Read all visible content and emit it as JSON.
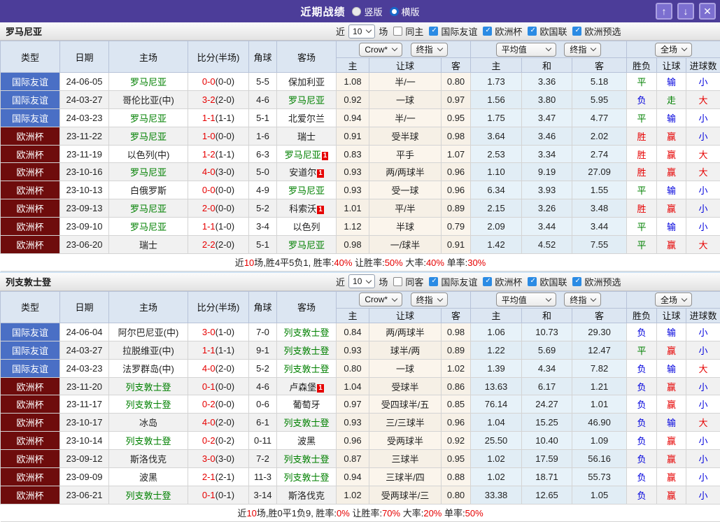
{
  "window": {
    "title": "近期战绩",
    "radio_vertical": "竖版",
    "radio_horizontal": "横版",
    "btn_up": "↑",
    "btn_down": "↓",
    "btn_close": "✕"
  },
  "colors": {
    "titlebar": "#4C3D99",
    "badge_friendly": "#4A6FC5",
    "badge_eurocup": "#6E0C0C",
    "team_green": "#008000",
    "score_red": "#E60000",
    "loss_blue": "#0000DD",
    "checkbox_blue": "#2B8BE4"
  },
  "table_columns": {
    "left": [
      "类型",
      "日期",
      "主场",
      "比分(半场)",
      "角球",
      "客场"
    ],
    "crow_group": {
      "select1": "Crow*",
      "select2": "终指",
      "cols": [
        "主",
        "让球",
        "客"
      ]
    },
    "avg_group": {
      "select1": "平均值",
      "select2": "终指",
      "cols": [
        "主",
        "和",
        "客"
      ]
    },
    "result_group": {
      "select1": "全场",
      "cols": [
        "胜负",
        "让球",
        "进球数"
      ]
    }
  },
  "sections": [
    {
      "team": "罗马尼亚",
      "filter": {
        "prefix": "近",
        "count": "10",
        "suffix": "场",
        "same": "同主",
        "same_checked": false,
        "leagues": [
          {
            "label": "国际友谊",
            "checked": true
          },
          {
            "label": "欧洲杯",
            "checked": true
          },
          {
            "label": "欧国联",
            "checked": true
          },
          {
            "label": "欧洲预选",
            "checked": true
          }
        ]
      },
      "rows": [
        {
          "type": "国际友谊",
          "type_style": "blue",
          "date": "24-06-05",
          "home": "罗马尼亚",
          "home_green": true,
          "home_badge": "",
          "score": "0-0",
          "half": "(0-0)",
          "corner": "5-5",
          "away": "保加利亚",
          "away_green": false,
          "away_badge": "",
          "crow": [
            "1.08",
            "半/一",
            "0.80"
          ],
          "avg": [
            "1.73",
            "3.36",
            "5.18"
          ],
          "results": [
            [
              "平",
              "g"
            ],
            [
              "输",
              "b"
            ],
            [
              "小",
              "b"
            ]
          ]
        },
        {
          "type": "国际友谊",
          "type_style": "blue",
          "date": "24-03-27",
          "home": "哥伦比亚(中)",
          "home_green": false,
          "home_badge": "",
          "score": "3-2",
          "half": "(2-0)",
          "corner": "4-6",
          "away": "罗马尼亚",
          "away_green": true,
          "away_badge": "",
          "crow": [
            "0.92",
            "一球",
            "0.97"
          ],
          "avg": [
            "1.56",
            "3.80",
            "5.95"
          ],
          "results": [
            [
              "负",
              "b"
            ],
            [
              "走",
              "g"
            ],
            [
              "大",
              "r"
            ]
          ]
        },
        {
          "type": "国际友谊",
          "type_style": "blue",
          "date": "24-03-23",
          "home": "罗马尼亚",
          "home_green": true,
          "home_badge": "",
          "score": "1-1",
          "half": "(1-1)",
          "corner": "5-1",
          "away": "北爱尔兰",
          "away_green": false,
          "away_badge": "",
          "crow": [
            "0.94",
            "半/一",
            "0.95"
          ],
          "avg": [
            "1.75",
            "3.47",
            "4.77"
          ],
          "results": [
            [
              "平",
              "g"
            ],
            [
              "输",
              "b"
            ],
            [
              "小",
              "b"
            ]
          ]
        },
        {
          "type": "欧洲杯",
          "type_style": "maroon",
          "date": "23-11-22",
          "home": "罗马尼亚",
          "home_green": true,
          "home_badge": "",
          "score": "1-0",
          "half": "(0-0)",
          "corner": "1-6",
          "away": "瑞士",
          "away_green": false,
          "away_badge": "",
          "crow": [
            "0.91",
            "受半球",
            "0.98"
          ],
          "avg": [
            "3.64",
            "3.46",
            "2.02"
          ],
          "results": [
            [
              "胜",
              "r"
            ],
            [
              "赢",
              "r"
            ],
            [
              "小",
              "b"
            ]
          ]
        },
        {
          "type": "欧洲杯",
          "type_style": "maroon",
          "date": "23-11-19",
          "home": "以色列(中)",
          "home_green": false,
          "home_badge": "",
          "score": "1-2",
          "half": "(1-1)",
          "corner": "6-3",
          "away": "罗马尼亚",
          "away_green": true,
          "away_badge": "1",
          "crow": [
            "0.83",
            "平手",
            "1.07"
          ],
          "avg": [
            "2.53",
            "3.34",
            "2.74"
          ],
          "results": [
            [
              "胜",
              "r"
            ],
            [
              "赢",
              "r"
            ],
            [
              "大",
              "r"
            ]
          ]
        },
        {
          "type": "欧洲杯",
          "type_style": "maroon",
          "date": "23-10-16",
          "home": "罗马尼亚",
          "home_green": true,
          "home_badge": "",
          "score": "4-0",
          "half": "(3-0)",
          "corner": "5-0",
          "away": "安道尔",
          "away_green": false,
          "away_badge": "1",
          "crow": [
            "0.93",
            "两/两球半",
            "0.96"
          ],
          "avg": [
            "1.10",
            "9.19",
            "27.09"
          ],
          "results": [
            [
              "胜",
              "r"
            ],
            [
              "赢",
              "r"
            ],
            [
              "大",
              "r"
            ]
          ]
        },
        {
          "type": "欧洲杯",
          "type_style": "maroon",
          "date": "23-10-13",
          "home": "白俄罗斯",
          "home_green": false,
          "home_badge": "",
          "score": "0-0",
          "half": "(0-0)",
          "corner": "4-9",
          "away": "罗马尼亚",
          "away_green": true,
          "away_badge": "",
          "crow": [
            "0.93",
            "受一球",
            "0.96"
          ],
          "avg": [
            "6.34",
            "3.93",
            "1.55"
          ],
          "results": [
            [
              "平",
              "g"
            ],
            [
              "输",
              "b"
            ],
            [
              "小",
              "b"
            ]
          ]
        },
        {
          "type": "欧洲杯",
          "type_style": "maroon",
          "date": "23-09-13",
          "home": "罗马尼亚",
          "home_green": true,
          "home_badge": "",
          "score": "2-0",
          "half": "(0-0)",
          "corner": "5-2",
          "away": "科索沃",
          "away_green": false,
          "away_badge": "1",
          "crow": [
            "1.01",
            "平/半",
            "0.89"
          ],
          "avg": [
            "2.15",
            "3.26",
            "3.48"
          ],
          "results": [
            [
              "胜",
              "r"
            ],
            [
              "赢",
              "r"
            ],
            [
              "小",
              "b"
            ]
          ]
        },
        {
          "type": "欧洲杯",
          "type_style": "maroon",
          "date": "23-09-10",
          "home": "罗马尼亚",
          "home_green": true,
          "home_badge": "",
          "score": "1-1",
          "half": "(1-0)",
          "corner": "3-4",
          "away": "以色列",
          "away_green": false,
          "away_badge": "",
          "crow": [
            "1.12",
            "半球",
            "0.79"
          ],
          "avg": [
            "2.09",
            "3.44",
            "3.44"
          ],
          "results": [
            [
              "平",
              "g"
            ],
            [
              "输",
              "b"
            ],
            [
              "小",
              "b"
            ]
          ]
        },
        {
          "type": "欧洲杯",
          "type_style": "maroon",
          "date": "23-06-20",
          "home": "瑞士",
          "home_green": false,
          "home_badge": "",
          "score": "2-2",
          "half": "(2-0)",
          "corner": "5-1",
          "away": "罗马尼亚",
          "away_green": true,
          "away_badge": "",
          "crow": [
            "0.98",
            "一/球半",
            "0.91"
          ],
          "avg": [
            "1.42",
            "4.52",
            "7.55"
          ],
          "results": [
            [
              "平",
              "g"
            ],
            [
              "赢",
              "r"
            ],
            [
              "大",
              "r"
            ]
          ]
        }
      ],
      "summary": [
        [
          "近",
          "k"
        ],
        [
          "10",
          "r"
        ],
        [
          "场,胜4平5负1, 胜率:",
          "k"
        ],
        [
          "40%",
          "r"
        ],
        [
          " 让胜率:",
          "k"
        ],
        [
          "50%",
          "r"
        ],
        [
          " 大率:",
          "k"
        ],
        [
          "40%",
          "r"
        ],
        [
          " 单率:",
          "k"
        ],
        [
          "30%",
          "r"
        ]
      ]
    },
    {
      "team": "列支敦士登",
      "filter": {
        "prefix": "近",
        "count": "10",
        "suffix": "场",
        "same": "同客",
        "same_checked": false,
        "leagues": [
          {
            "label": "国际友谊",
            "checked": true
          },
          {
            "label": "欧洲杯",
            "checked": true
          },
          {
            "label": "欧国联",
            "checked": true
          },
          {
            "label": "欧洲预选",
            "checked": true
          }
        ]
      },
      "rows": [
        {
          "type": "国际友谊",
          "type_style": "blue",
          "date": "24-06-04",
          "home": "阿尔巴尼亚(中)",
          "home_green": false,
          "home_badge": "",
          "score": "3-0",
          "half": "(1-0)",
          "corner": "7-0",
          "away": "列支敦士登",
          "away_green": true,
          "away_badge": "",
          "crow": [
            "0.84",
            "两/两球半",
            "0.98"
          ],
          "avg": [
            "1.06",
            "10.73",
            "29.30"
          ],
          "results": [
            [
              "负",
              "b"
            ],
            [
              "输",
              "b"
            ],
            [
              "小",
              "b"
            ]
          ]
        },
        {
          "type": "国际友谊",
          "type_style": "blue",
          "date": "24-03-27",
          "home": "拉脱维亚(中)",
          "home_green": false,
          "home_badge": "",
          "score": "1-1",
          "half": "(1-1)",
          "corner": "9-1",
          "away": "列支敦士登",
          "away_green": true,
          "away_badge": "",
          "crow": [
            "0.93",
            "球半/两",
            "0.89"
          ],
          "avg": [
            "1.22",
            "5.69",
            "12.47"
          ],
          "results": [
            [
              "平",
              "g"
            ],
            [
              "赢",
              "r"
            ],
            [
              "小",
              "b"
            ]
          ]
        },
        {
          "type": "国际友谊",
          "type_style": "blue",
          "date": "24-03-23",
          "home": "法罗群岛(中)",
          "home_green": false,
          "home_badge": "",
          "score": "4-0",
          "half": "(2-0)",
          "corner": "5-2",
          "away": "列支敦士登",
          "away_green": true,
          "away_badge": "",
          "crow": [
            "0.80",
            "一球",
            "1.02"
          ],
          "avg": [
            "1.39",
            "4.34",
            "7.82"
          ],
          "results": [
            [
              "负",
              "b"
            ],
            [
              "输",
              "b"
            ],
            [
              "大",
              "r"
            ]
          ]
        },
        {
          "type": "欧洲杯",
          "type_style": "maroon",
          "date": "23-11-20",
          "home": "列支敦士登",
          "home_green": true,
          "home_badge": "",
          "score": "0-1",
          "half": "(0-0)",
          "corner": "4-6",
          "away": "卢森堡",
          "away_green": false,
          "away_badge": "1",
          "crow": [
            "1.04",
            "受球半",
            "0.86"
          ],
          "avg": [
            "13.63",
            "6.17",
            "1.21"
          ],
          "results": [
            [
              "负",
              "b"
            ],
            [
              "赢",
              "r"
            ],
            [
              "小",
              "b"
            ]
          ]
        },
        {
          "type": "欧洲杯",
          "type_style": "maroon",
          "date": "23-11-17",
          "home": "列支敦士登",
          "home_green": true,
          "home_badge": "",
          "score": "0-2",
          "half": "(0-0)",
          "corner": "0-6",
          "away": "葡萄牙",
          "away_green": false,
          "away_badge": "",
          "crow": [
            "0.97",
            "受四球半/五",
            "0.85"
          ],
          "avg": [
            "76.14",
            "24.27",
            "1.01"
          ],
          "results": [
            [
              "负",
              "b"
            ],
            [
              "赢",
              "r"
            ],
            [
              "小",
              "b"
            ]
          ]
        },
        {
          "type": "欧洲杯",
          "type_style": "maroon",
          "date": "23-10-17",
          "home": "冰岛",
          "home_green": false,
          "home_badge": "",
          "score": "4-0",
          "half": "(2-0)",
          "corner": "6-1",
          "away": "列支敦士登",
          "away_green": true,
          "away_badge": "",
          "crow": [
            "0.93",
            "三/三球半",
            "0.96"
          ],
          "avg": [
            "1.04",
            "15.25",
            "46.90"
          ],
          "results": [
            [
              "负",
              "b"
            ],
            [
              "输",
              "b"
            ],
            [
              "大",
              "r"
            ]
          ]
        },
        {
          "type": "欧洲杯",
          "type_style": "maroon",
          "date": "23-10-14",
          "home": "列支敦士登",
          "home_green": true,
          "home_badge": "",
          "score": "0-2",
          "half": "(0-2)",
          "corner": "0-11",
          "away": "波黑",
          "away_green": false,
          "away_badge": "",
          "crow": [
            "0.96",
            "受两球半",
            "0.92"
          ],
          "avg": [
            "25.50",
            "10.40",
            "1.09"
          ],
          "results": [
            [
              "负",
              "b"
            ],
            [
              "赢",
              "r"
            ],
            [
              "小",
              "b"
            ]
          ]
        },
        {
          "type": "欧洲杯",
          "type_style": "maroon",
          "date": "23-09-12",
          "home": "斯洛伐克",
          "home_green": false,
          "home_badge": "",
          "score": "3-0",
          "half": "(3-0)",
          "corner": "7-2",
          "away": "列支敦士登",
          "away_green": true,
          "away_badge": "",
          "crow": [
            "0.87",
            "三球半",
            "0.95"
          ],
          "avg": [
            "1.02",
            "17.59",
            "56.16"
          ],
          "results": [
            [
              "负",
              "b"
            ],
            [
              "赢",
              "r"
            ],
            [
              "小",
              "b"
            ]
          ]
        },
        {
          "type": "欧洲杯",
          "type_style": "maroon",
          "date": "23-09-09",
          "home": "波黑",
          "home_green": false,
          "home_badge": "",
          "score": "2-1",
          "half": "(2-1)",
          "corner": "11-3",
          "away": "列支敦士登",
          "away_green": true,
          "away_badge": "",
          "crow": [
            "0.94",
            "三球半/四",
            "0.88"
          ],
          "avg": [
            "1.02",
            "18.71",
            "55.73"
          ],
          "results": [
            [
              "负",
              "b"
            ],
            [
              "赢",
              "r"
            ],
            [
              "小",
              "b"
            ]
          ]
        },
        {
          "type": "欧洲杯",
          "type_style": "maroon",
          "date": "23-06-21",
          "home": "列支敦士登",
          "home_green": true,
          "home_badge": "",
          "score": "0-1",
          "half": "(0-1)",
          "corner": "3-14",
          "away": "斯洛伐克",
          "away_green": false,
          "away_badge": "",
          "crow": [
            "1.02",
            "受两球半/三",
            "0.80"
          ],
          "avg": [
            "33.38",
            "12.65",
            "1.05"
          ],
          "results": [
            [
              "负",
              "b"
            ],
            [
              "赢",
              "r"
            ],
            [
              "小",
              "b"
            ]
          ]
        }
      ],
      "summary": [
        [
          "近",
          "k"
        ],
        [
          "10",
          "r"
        ],
        [
          "场,胜0平1负9, 胜率:",
          "k"
        ],
        [
          "0%",
          "r"
        ],
        [
          " 让胜率:",
          "k"
        ],
        [
          "70%",
          "r"
        ],
        [
          " 大率:",
          "k"
        ],
        [
          "20%",
          "r"
        ],
        [
          " 单率:",
          "k"
        ],
        [
          "50%",
          "r"
        ]
      ]
    }
  ]
}
